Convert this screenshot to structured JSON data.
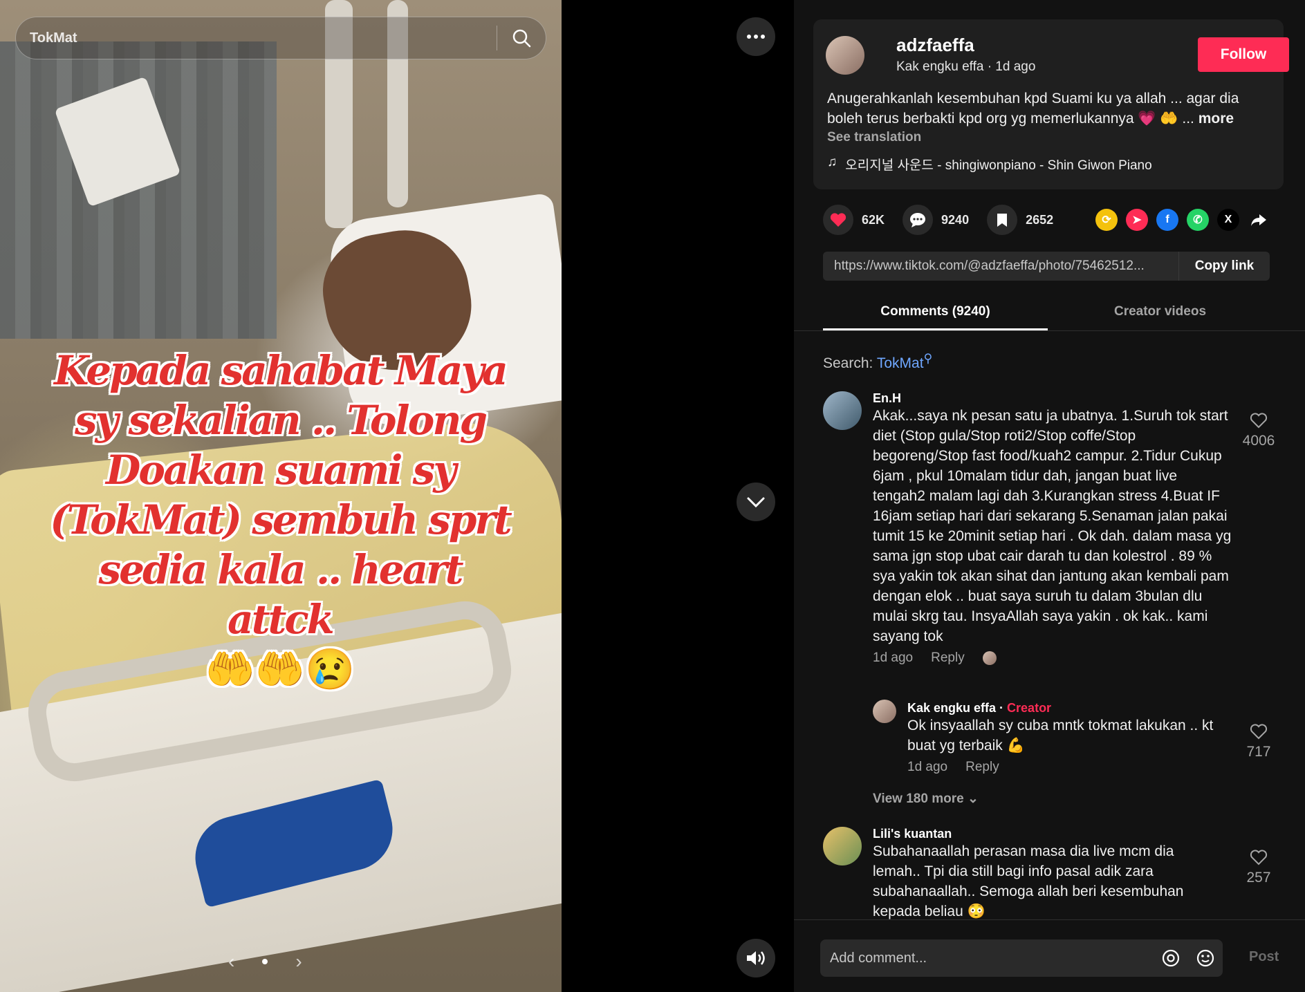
{
  "search": {
    "value": "TokMat"
  },
  "overlay": {
    "line1": "Kepada sahabat Maya",
    "line2": "sy sekalian .. Tolong",
    "line3": "Doakan suami sy",
    "line4": "(TokMat) sembuh sprt",
    "line5": "sedia kala .. heart attck",
    "emoji": "🤲🤲😢"
  },
  "post": {
    "username": "adzfaeffa",
    "subtitle": "Kak engku effa · 1d ago",
    "follow_label": "Follow",
    "caption": "Anugerahkanlah kesembuhan kpd Suami ku ya allah ... agar dia boleh terus berbakti kpd org yg memerlukannya 💗 🤲 ...",
    "more_label": "more",
    "see_translation": "See translation",
    "music": "오리지널 사운드 - shingiwonpiano - Shin Giwon Piano"
  },
  "actions": {
    "likes": "62K",
    "comments": "9240",
    "saves": "2652"
  },
  "share_icons": [
    {
      "name": "repost",
      "color": "#f4c20d",
      "glyph": "⟳"
    },
    {
      "name": "send",
      "color": "#fe2c55",
      "glyph": "➤"
    },
    {
      "name": "facebook",
      "color": "#1877f2",
      "glyph": "f"
    },
    {
      "name": "whatsapp",
      "color": "#25d366",
      "glyph": "✆"
    },
    {
      "name": "x",
      "color": "#000000",
      "glyph": "X"
    }
  ],
  "link": {
    "url": "https://www.tiktok.com/@adzfaeffa/photo/75462512...",
    "copy_label": "Copy link"
  },
  "tabs": {
    "comments": "Comments (9240)",
    "creator": "Creator videos"
  },
  "search_keyword": {
    "label": "Search:",
    "keyword": "TokMat"
  },
  "comments": [
    {
      "name": "En.H",
      "text": "Akak...saya nk pesan satu ja ubatnya. 1.Suruh tok start diet (Stop gula/Stop roti2/Stop coffe/Stop begoreng/Stop fast food/kuah2 campur. 2.Tidur Cukup 6jam , pkul 10malam tidur dah, jangan buat live tengah2 malam lagi dah 3.Kurangkan stress 4.Buat IF 16jam setiap hari dari sekarang 5.Senaman jalan pakai tumit 15 ke 20minit setiap hari . Ok dah. dalam masa yg sama jgn stop ubat cair darah tu dan kolestrol . 89 % sya yakin tok akan sihat dan jantung akan kembali pam dengan elok .. buat saya suruh tu dalam 3bulan dlu mulai skrg tau. InsyaAllah saya yakin . ok kak.. kami sayang tok",
      "time": "1d ago",
      "reply": "Reply",
      "likes": "4006"
    },
    {
      "name": "Kak engku effa",
      "badge": "Creator",
      "text": "Ok insyaallah sy cuba mntk tokmat lakukan .. kt buat yg terbaik 💪",
      "time": "1d ago",
      "reply": "Reply",
      "likes": "717"
    },
    {
      "name": "Lili's kuantan",
      "text": "Subahanaallah perasan masa dia live mcm dia lemah.. Tpi dia still bagi info pasal adik zara subahanaallah.. Semoga allah beri kesembuhan kepada beliau 😳",
      "likes": "257"
    }
  ],
  "view_more": "View 180 more",
  "composer": {
    "placeholder": "Add comment...",
    "post_label": "Post"
  }
}
